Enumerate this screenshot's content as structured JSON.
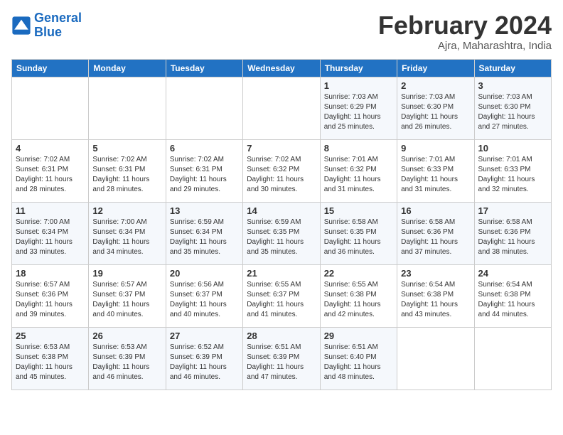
{
  "header": {
    "logo_line1": "General",
    "logo_line2": "Blue",
    "month_year": "February 2024",
    "location": "Ajra, Maharashtra, India"
  },
  "days_of_week": [
    "Sunday",
    "Monday",
    "Tuesday",
    "Wednesday",
    "Thursday",
    "Friday",
    "Saturday"
  ],
  "weeks": [
    [
      {
        "day": "",
        "info": ""
      },
      {
        "day": "",
        "info": ""
      },
      {
        "day": "",
        "info": ""
      },
      {
        "day": "",
        "info": ""
      },
      {
        "day": "1",
        "info": "Sunrise: 7:03 AM\nSunset: 6:29 PM\nDaylight: 11 hours\nand 25 minutes."
      },
      {
        "day": "2",
        "info": "Sunrise: 7:03 AM\nSunset: 6:30 PM\nDaylight: 11 hours\nand 26 minutes."
      },
      {
        "day": "3",
        "info": "Sunrise: 7:03 AM\nSunset: 6:30 PM\nDaylight: 11 hours\nand 27 minutes."
      }
    ],
    [
      {
        "day": "4",
        "info": "Sunrise: 7:02 AM\nSunset: 6:31 PM\nDaylight: 11 hours\nand 28 minutes."
      },
      {
        "day": "5",
        "info": "Sunrise: 7:02 AM\nSunset: 6:31 PM\nDaylight: 11 hours\nand 28 minutes."
      },
      {
        "day": "6",
        "info": "Sunrise: 7:02 AM\nSunset: 6:31 PM\nDaylight: 11 hours\nand 29 minutes."
      },
      {
        "day": "7",
        "info": "Sunrise: 7:02 AM\nSunset: 6:32 PM\nDaylight: 11 hours\nand 30 minutes."
      },
      {
        "day": "8",
        "info": "Sunrise: 7:01 AM\nSunset: 6:32 PM\nDaylight: 11 hours\nand 31 minutes."
      },
      {
        "day": "9",
        "info": "Sunrise: 7:01 AM\nSunset: 6:33 PM\nDaylight: 11 hours\nand 31 minutes."
      },
      {
        "day": "10",
        "info": "Sunrise: 7:01 AM\nSunset: 6:33 PM\nDaylight: 11 hours\nand 32 minutes."
      }
    ],
    [
      {
        "day": "11",
        "info": "Sunrise: 7:00 AM\nSunset: 6:34 PM\nDaylight: 11 hours\nand 33 minutes."
      },
      {
        "day": "12",
        "info": "Sunrise: 7:00 AM\nSunset: 6:34 PM\nDaylight: 11 hours\nand 34 minutes."
      },
      {
        "day": "13",
        "info": "Sunrise: 6:59 AM\nSunset: 6:34 PM\nDaylight: 11 hours\nand 35 minutes."
      },
      {
        "day": "14",
        "info": "Sunrise: 6:59 AM\nSunset: 6:35 PM\nDaylight: 11 hours\nand 35 minutes."
      },
      {
        "day": "15",
        "info": "Sunrise: 6:58 AM\nSunset: 6:35 PM\nDaylight: 11 hours\nand 36 minutes."
      },
      {
        "day": "16",
        "info": "Sunrise: 6:58 AM\nSunset: 6:36 PM\nDaylight: 11 hours\nand 37 minutes."
      },
      {
        "day": "17",
        "info": "Sunrise: 6:58 AM\nSunset: 6:36 PM\nDaylight: 11 hours\nand 38 minutes."
      }
    ],
    [
      {
        "day": "18",
        "info": "Sunrise: 6:57 AM\nSunset: 6:36 PM\nDaylight: 11 hours\nand 39 minutes."
      },
      {
        "day": "19",
        "info": "Sunrise: 6:57 AM\nSunset: 6:37 PM\nDaylight: 11 hours\nand 40 minutes."
      },
      {
        "day": "20",
        "info": "Sunrise: 6:56 AM\nSunset: 6:37 PM\nDaylight: 11 hours\nand 40 minutes."
      },
      {
        "day": "21",
        "info": "Sunrise: 6:55 AM\nSunset: 6:37 PM\nDaylight: 11 hours\nand 41 minutes."
      },
      {
        "day": "22",
        "info": "Sunrise: 6:55 AM\nSunset: 6:38 PM\nDaylight: 11 hours\nand 42 minutes."
      },
      {
        "day": "23",
        "info": "Sunrise: 6:54 AM\nSunset: 6:38 PM\nDaylight: 11 hours\nand 43 minutes."
      },
      {
        "day": "24",
        "info": "Sunrise: 6:54 AM\nSunset: 6:38 PM\nDaylight: 11 hours\nand 44 minutes."
      }
    ],
    [
      {
        "day": "25",
        "info": "Sunrise: 6:53 AM\nSunset: 6:38 PM\nDaylight: 11 hours\nand 45 minutes."
      },
      {
        "day": "26",
        "info": "Sunrise: 6:53 AM\nSunset: 6:39 PM\nDaylight: 11 hours\nand 46 minutes."
      },
      {
        "day": "27",
        "info": "Sunrise: 6:52 AM\nSunset: 6:39 PM\nDaylight: 11 hours\nand 46 minutes."
      },
      {
        "day": "28",
        "info": "Sunrise: 6:51 AM\nSunset: 6:39 PM\nDaylight: 11 hours\nand 47 minutes."
      },
      {
        "day": "29",
        "info": "Sunrise: 6:51 AM\nSunset: 6:40 PM\nDaylight: 11 hours\nand 48 minutes."
      },
      {
        "day": "",
        "info": ""
      },
      {
        "day": "",
        "info": ""
      }
    ]
  ]
}
